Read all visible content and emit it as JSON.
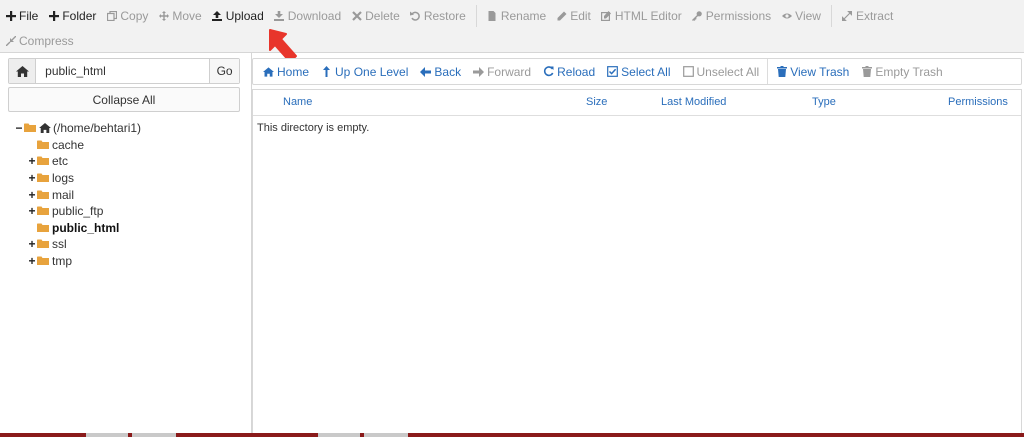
{
  "toolbar": {
    "row1": [
      {
        "id": "file",
        "label": "File",
        "icon": "plus-icon",
        "enabled": true
      },
      {
        "id": "folder",
        "label": "Folder",
        "icon": "plus-icon",
        "enabled": true
      },
      {
        "id": "copy",
        "label": "Copy",
        "icon": "copy-icon",
        "enabled": false
      },
      {
        "id": "move",
        "label": "Move",
        "icon": "move-icon",
        "enabled": false
      },
      {
        "id": "upload",
        "label": "Upload",
        "icon": "upload-icon",
        "enabled": true
      },
      {
        "id": "download",
        "label": "Download",
        "icon": "download-icon",
        "enabled": false
      },
      {
        "id": "delete",
        "label": "Delete",
        "icon": "close-icon",
        "enabled": false
      },
      {
        "id": "restore",
        "label": "Restore",
        "icon": "undo-icon",
        "enabled": false
      },
      {
        "id": "rename",
        "label": "Rename",
        "icon": "file-icon",
        "enabled": false
      },
      {
        "id": "edit",
        "label": "Edit",
        "icon": "pencil-icon",
        "enabled": false
      },
      {
        "id": "html_editor",
        "label": "HTML Editor",
        "icon": "edit-square-icon",
        "enabled": false
      },
      {
        "id": "permissions",
        "label": "Permissions",
        "icon": "key-icon",
        "enabled": false
      },
      {
        "id": "view",
        "label": "View",
        "icon": "eye-icon",
        "enabled": false
      },
      {
        "id": "extract",
        "label": "Extract",
        "icon": "expand-icon",
        "enabled": false
      }
    ],
    "row2": [
      {
        "id": "compress",
        "label": "Compress",
        "icon": "compress-icon",
        "enabled": false
      }
    ]
  },
  "path": {
    "value": "public_html",
    "go_label": "Go",
    "collapse_all_label": "Collapse All"
  },
  "tree": [
    {
      "label": "(/home/behtari1)",
      "toggle": "−",
      "icon": "home-icon",
      "depth": 0,
      "bold": false
    },
    {
      "label": "cache",
      "toggle": "",
      "icon": "folder-icon",
      "depth": 1,
      "bold": false
    },
    {
      "label": "etc",
      "toggle": "+",
      "icon": "folder-icon",
      "depth": 1,
      "bold": false
    },
    {
      "label": "logs",
      "toggle": "+",
      "icon": "folder-icon",
      "depth": 1,
      "bold": false
    },
    {
      "label": "mail",
      "toggle": "+",
      "icon": "folder-icon",
      "depth": 1,
      "bold": false
    },
    {
      "label": "public_ftp",
      "toggle": "+",
      "icon": "folder-icon",
      "depth": 1,
      "bold": false
    },
    {
      "label": "public_html",
      "toggle": "",
      "icon": "folder-icon",
      "depth": 1,
      "bold": true
    },
    {
      "label": "ssl",
      "toggle": "+",
      "icon": "folder-icon",
      "depth": 1,
      "bold": false
    },
    {
      "label": "tmp",
      "toggle": "+",
      "icon": "folder-icon",
      "depth": 1,
      "bold": false
    }
  ],
  "nav": {
    "home": "Home",
    "up_one_level": "Up One Level",
    "back": "Back",
    "forward": "Forward",
    "reload": "Reload",
    "select_all": "Select All",
    "unselect_all": "Unselect All",
    "view_trash": "View Trash",
    "empty_trash": "Empty Trash"
  },
  "columns": {
    "name": "Name",
    "size": "Size",
    "last_modified": "Last Modified",
    "type": "Type",
    "permissions": "Permissions"
  },
  "empty_message": "This directory is empty.",
  "colors": {
    "link": "#2a6ebb",
    "folder": "#e8a33d",
    "arrow": "#e8352b",
    "disabled": "#9a9a9a"
  }
}
